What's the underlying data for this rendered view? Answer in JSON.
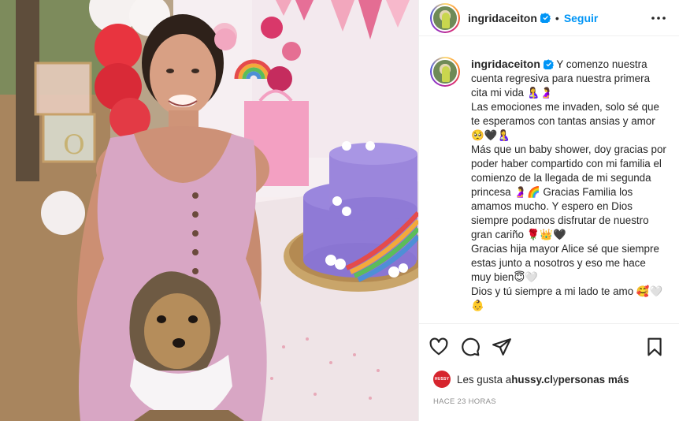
{
  "header": {
    "username": "ingridaceiton",
    "separator": "•",
    "follow_label": "Seguir"
  },
  "caption": {
    "username": "ingridaceiton",
    "text": " Y comenzo nuestra cuenta regresiva para nuestra primera cita mi vida 🤱🤰\nLas emociones me invaden, solo sé que te esperamos con tantas ansias y amor 🥺🖤🤱\nMás que un baby shower, doy gracias por poder haber compartido con mi familia el comienzo de la llegada de mi segunda princesa 🤰🌈 Gracias Familia los amamos mucho. Y espero en Dios siempre podamos disfrutar de nuestro gran cariño 🌹👑🖤\nGracias hija mayor Alice sé que siempre estas junto a nosotros y eso me hace muy bien😇🤍\nDios y tú siempre a mi lado te amo 🥰🤍👶"
  },
  "likes": {
    "avatar_text": "HUSSY",
    "prefix": "Les gusta a ",
    "user": "hussy.cl",
    "middle": " y ",
    "others": "personas más"
  },
  "timestamp": "HACE 23 HORAS",
  "icons": {
    "verified": "verified-badge-icon",
    "more": "more-options-icon",
    "like": "heart-icon",
    "comment": "comment-icon",
    "share": "send-icon",
    "save": "bookmark-icon"
  },
  "colors": {
    "accent": "#0095f6",
    "text": "#262626",
    "muted": "#8e8e8e",
    "border": "#efefef"
  }
}
